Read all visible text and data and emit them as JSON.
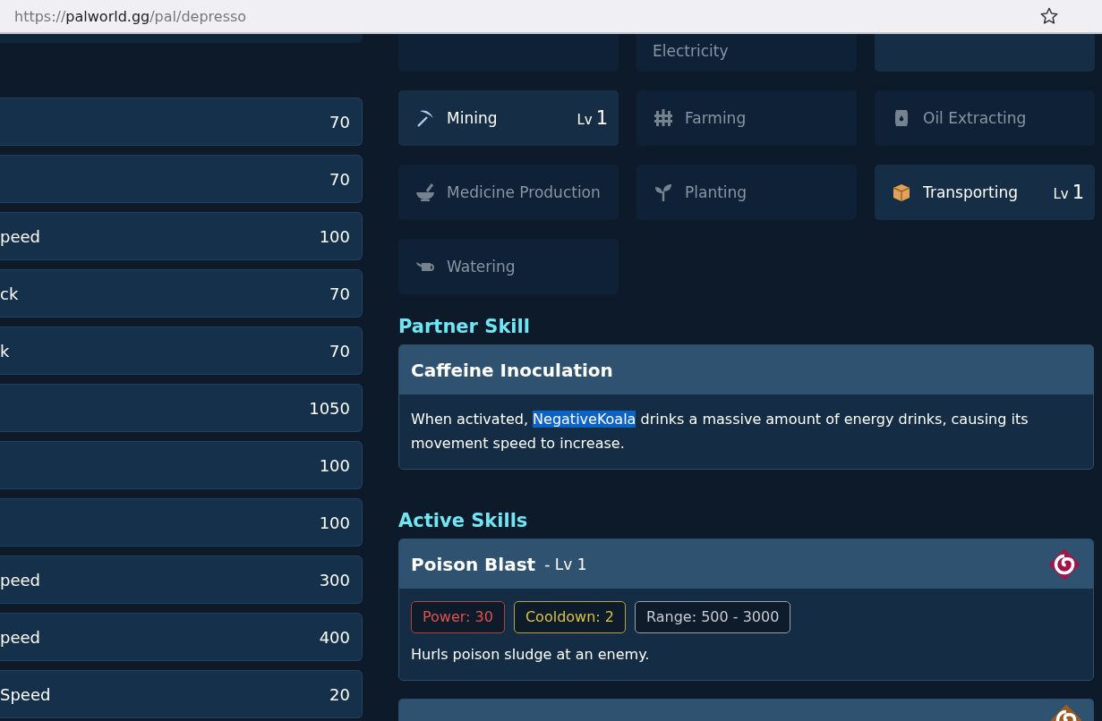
{
  "browser": {
    "url_scheme": "https://",
    "url_host": "palworld.gg",
    "url_path": "/pal/depresso"
  },
  "stats": [
    {
      "value": "70"
    },
    {
      "value": "70"
    },
    {
      "label": "peed",
      "value": "100"
    },
    {
      "label": "ck",
      "value": "70"
    },
    {
      "label": "k",
      "value": "70"
    },
    {
      "value": "1050"
    },
    {
      "value": "100"
    },
    {
      "value": "100"
    },
    {
      "label": "peed",
      "value": "300"
    },
    {
      "label": "peed",
      "value": "400"
    },
    {
      "label": "Speed",
      "value": "20"
    }
  ],
  "work_suitability": [
    {
      "active": false
    },
    {
      "name": "Electricity",
      "active": false
    },
    {
      "active": true
    },
    {
      "name": "Mining",
      "kind": "pickaxe",
      "active": true,
      "lv": "Lv",
      "level": "1"
    },
    {
      "name": "Farming",
      "kind": "fence",
      "active": false
    },
    {
      "name": "Oil Extracting",
      "kind": "barrel",
      "active": false
    },
    {
      "name": "Medicine Production",
      "kind": "bowl",
      "active": false
    },
    {
      "name": "Planting",
      "kind": "sprout",
      "active": false
    },
    {
      "name": "Transporting",
      "kind": "box",
      "active": true,
      "lv": "Lv",
      "level": "1"
    },
    {
      "name": "Watering",
      "kind": "can",
      "active": false
    }
  ],
  "partner_skill": {
    "heading": "Partner Skill",
    "name": "Caffeine Inoculation",
    "description": [
      {
        "text": "When activated, ",
        "highlighted": false
      },
      {
        "text": "NegativeKoala",
        "highlighted": true
      },
      {
        "text": " drinks a massive amount of energy drinks, causing its movement speed to increase.",
        "highlighted": false
      }
    ]
  },
  "active_skills": {
    "heading": "Active Skills",
    "skills": [
      {
        "name": "Poison Blast",
        "level": "- Lv 1",
        "color": "#a3154a",
        "tags": [
          {
            "kind": "power",
            "text": "Power:  30"
          },
          {
            "kind": "cooldown",
            "text": "Cooldown:  2"
          },
          {
            "kind": "range",
            "text": "Range:  500 - 3000"
          }
        ],
        "description": "Hurls poison sludge at an enemy."
      },
      {
        "color": "#9a5a22"
      }
    ]
  }
}
